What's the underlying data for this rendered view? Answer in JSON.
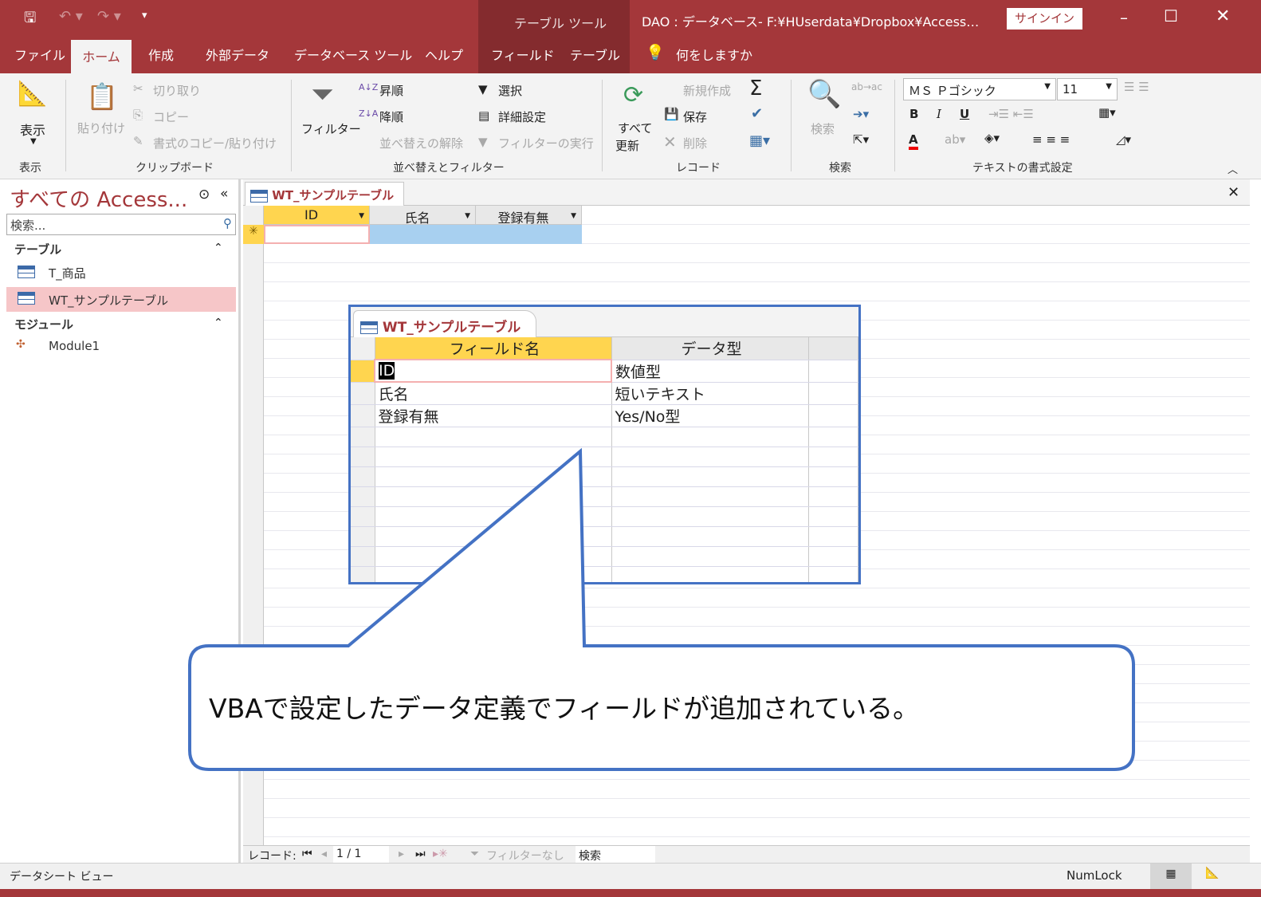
{
  "window": {
    "title": "DAO : データベース- F:¥HUserdata¥Dropbox¥Access…",
    "tool_context": "テーブル ツール",
    "signin": "サインイン"
  },
  "tabs": [
    "ファイル",
    "ホーム",
    "作成",
    "外部データ",
    "データベース ツール",
    "ヘルプ",
    "フィールド",
    "テーブル"
  ],
  "tell_me": "何をしますか",
  "ribbon": {
    "view": {
      "button": "表示",
      "group": "表示"
    },
    "clipboard": {
      "paste": "貼り付け",
      "cut": "切り取り",
      "copy": "コピー",
      "format_painter": "書式のコピー/貼り付け",
      "group": "クリップボード"
    },
    "sort": {
      "filter": "フィルター",
      "asc": "昇順",
      "desc": "降順",
      "clear": "並べ替えの解除",
      "selection": "選択",
      "advanced": "詳細設定",
      "toggle": "フィルターの実行",
      "group": "並べ替えとフィルター"
    },
    "records": {
      "refresh_line1": "すべて",
      "refresh_line2": "更新",
      "new": "新規作成",
      "save": "保存",
      "delete": "削除",
      "group": "レコード"
    },
    "find": {
      "find": "検索",
      "group": "検索"
    },
    "text": {
      "font": "ＭＳ Ｐゴシック",
      "size": "11",
      "bold": "B",
      "italic": "I",
      "underline": "U",
      "font_color": "A",
      "group": "テキストの書式設定"
    }
  },
  "nav": {
    "title": "すべての Access...",
    "search_placeholder": "検索...",
    "sections": [
      {
        "label": "テーブル",
        "items": [
          "T_商品",
          "WT_サンプルテーブル"
        ]
      },
      {
        "label": "モジュール",
        "items": [
          "Module1"
        ]
      }
    ]
  },
  "datasheet": {
    "tab": "WT_サンプルテーブル",
    "columns": [
      "ID",
      "氏名",
      "登録有無"
    ],
    "new_row_marker": "✳"
  },
  "design": {
    "tab": "WT_サンプルテーブル",
    "headers": [
      "フィールド名",
      "データ型"
    ],
    "rows": [
      [
        "ID",
        "数値型"
      ],
      [
        "氏名",
        "短いテキスト"
      ],
      [
        "登録有無",
        "Yes/No型"
      ]
    ]
  },
  "callout": "VBAで設定したデータ定義でフィールドが追加されている。",
  "record_nav": {
    "label": "レコード:",
    "position": "1 / 1",
    "filter": "フィルターなし",
    "search": "検索"
  },
  "status": {
    "view": "データシート ビュー",
    "numlock": "NumLock"
  },
  "colors": {
    "brand": "#a4373a",
    "callout_border": "#4472c4"
  }
}
